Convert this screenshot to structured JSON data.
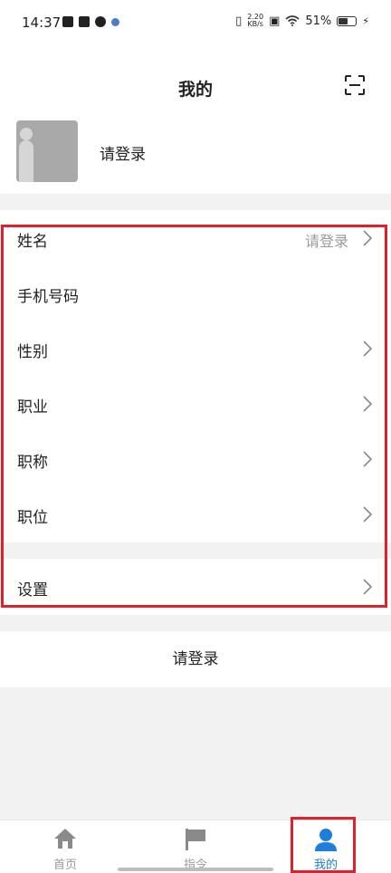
{
  "status_bar": {
    "time": "14:37",
    "net_speed_value": "2.20",
    "net_speed_unit": "KB/s",
    "battery": "51%"
  },
  "header": {
    "title": "我的",
    "login_prompt": "请登录"
  },
  "profile_rows": [
    {
      "label": "姓名",
      "value": "请登录",
      "has_chevron": true
    },
    {
      "label": "手机号码",
      "value": "",
      "has_chevron": false
    },
    {
      "label": "性别",
      "value": "",
      "has_chevron": true
    },
    {
      "label": "职业",
      "value": "",
      "has_chevron": true
    },
    {
      "label": "职称",
      "value": "",
      "has_chevron": true
    },
    {
      "label": "职位",
      "value": "",
      "has_chevron": true
    }
  ],
  "settings_row": {
    "label": "设置"
  },
  "login_button": "请登录",
  "tabs": [
    {
      "label": "首页",
      "icon": "home-icon"
    },
    {
      "label": "指令",
      "icon": "flag-icon"
    },
    {
      "label": "我的",
      "icon": "person-icon",
      "active": true
    }
  ],
  "colors": {
    "accent": "#1e7fd8",
    "highlight_box": "#e0202b"
  }
}
